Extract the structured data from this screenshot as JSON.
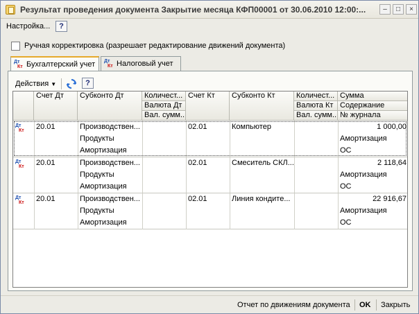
{
  "window": {
    "title": "Результат проведения документа Закрытие месяца КФП00001 от 30.06.2010 12:00:..."
  },
  "menu": {
    "settings": "Настройка...",
    "help": "?"
  },
  "manual_adjust": {
    "label": "Ручная корректировка (разрешает редактирование движений документа)",
    "checked": false
  },
  "tabs": [
    {
      "label": "Бухгалтерский учет",
      "active": true
    },
    {
      "label": "Налоговый учет",
      "active": false
    }
  ],
  "toolbar": {
    "actions": "Действия",
    "help": "?"
  },
  "columns": {
    "c1": "Счет Дт",
    "c2": "Субконто Дт",
    "c3a": "Количест...",
    "c3b": "Валюта Дт",
    "c3c": "Вал. сумм...",
    "c4": "Счет Кт",
    "c5": "Субконто Кт",
    "c6a": "Количест...",
    "c6b": "Валюта Кт",
    "c6c": "Вал. сумм...",
    "c7a": "Сумма",
    "c7b": "Содержание",
    "c7c": "№ журнала"
  },
  "rows": [
    {
      "account_dt": "20.01",
      "subconto_dt": [
        "Производствен...",
        "Продукты",
        "Амортизация"
      ],
      "account_kt": "02.01",
      "subconto_kt": "Компьютер",
      "amount": "1 000,00",
      "content": "Амортизация",
      "journal": "ОС"
    },
    {
      "account_dt": "20.01",
      "subconto_dt": [
        "Производствен...",
        "Продукты",
        "Амортизация"
      ],
      "account_kt": "02.01",
      "subconto_kt": "Смеситель СКЛ...",
      "amount": "2 118,64",
      "content": "Амортизация",
      "journal": "ОС"
    },
    {
      "account_dt": "20.01",
      "subconto_dt": [
        "Производствен...",
        "Продукты",
        "Амортизация"
      ],
      "account_kt": "02.01",
      "subconto_kt": "Линия кондите...",
      "amount": "22 916,67",
      "content": "Амортизация",
      "journal": "ОС"
    }
  ],
  "row_icon": {
    "dt": "Дт",
    "kt": "Кт"
  },
  "statusbar": {
    "report": "Отчет по движениям документа",
    "ok": "OK",
    "close": "Закрыть"
  }
}
